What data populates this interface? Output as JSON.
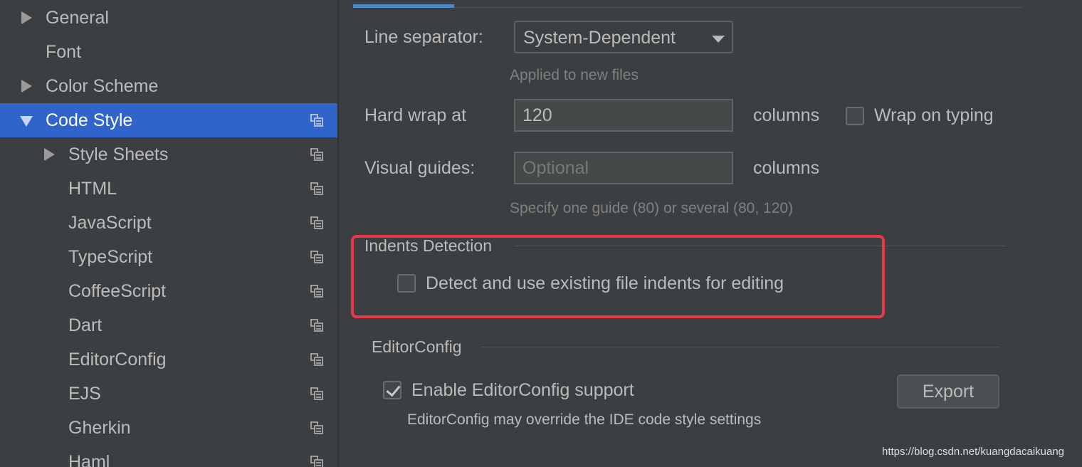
{
  "sidebar": {
    "items": [
      {
        "label": "General",
        "arrow": "right",
        "indent": 0,
        "copy_icon": false,
        "selected": false
      },
      {
        "label": "Font",
        "arrow": "none",
        "indent": 0,
        "copy_icon": false,
        "selected": false
      },
      {
        "label": "Color Scheme",
        "arrow": "right",
        "indent": 0,
        "copy_icon": false,
        "selected": false
      },
      {
        "label": "Code Style",
        "arrow": "down",
        "indent": 0,
        "copy_icon": true,
        "selected": true
      },
      {
        "label": "Style Sheets",
        "arrow": "right",
        "indent": 1,
        "copy_icon": true,
        "selected": false
      },
      {
        "label": "HTML",
        "arrow": "none",
        "indent": 1,
        "copy_icon": true,
        "selected": false
      },
      {
        "label": "JavaScript",
        "arrow": "none",
        "indent": 1,
        "copy_icon": true,
        "selected": false
      },
      {
        "label": "TypeScript",
        "arrow": "none",
        "indent": 1,
        "copy_icon": true,
        "selected": false
      },
      {
        "label": "CoffeeScript",
        "arrow": "none",
        "indent": 1,
        "copy_icon": true,
        "selected": false
      },
      {
        "label": "Dart",
        "arrow": "none",
        "indent": 1,
        "copy_icon": true,
        "selected": false
      },
      {
        "label": "EditorConfig",
        "arrow": "none",
        "indent": 1,
        "copy_icon": true,
        "selected": false
      },
      {
        "label": "EJS",
        "arrow": "none",
        "indent": 1,
        "copy_icon": true,
        "selected": false
      },
      {
        "label": "Gherkin",
        "arrow": "none",
        "indent": 1,
        "copy_icon": true,
        "selected": false
      },
      {
        "label": "Haml",
        "arrow": "none",
        "indent": 1,
        "copy_icon": true,
        "selected": false
      }
    ]
  },
  "general": {
    "line_separator_label": "Line separator:",
    "line_separator_value": "System-Dependent",
    "line_separator_hint": "Applied to new files",
    "hard_wrap_label": "Hard wrap at",
    "hard_wrap_value": "120",
    "hard_wrap_unit": "columns",
    "wrap_on_typing_label": "Wrap on typing",
    "wrap_on_typing_checked": false,
    "visual_guides_label": "Visual guides:",
    "visual_guides_value": "",
    "visual_guides_placeholder": "Optional",
    "visual_guides_unit": "columns",
    "visual_guides_hint": "Specify one guide (80) or several (80, 120)"
  },
  "indents_detection": {
    "title": "Indents Detection",
    "checkbox_label": "Detect and use existing file indents for editing",
    "checked": false
  },
  "editorconfig": {
    "title": "EditorConfig",
    "enable_label": "Enable EditorConfig support",
    "enable_checked": true,
    "note": "EditorConfig may override the IDE code style settings",
    "export_label": "Export"
  },
  "watermark": "https://blog.csdn.net/kuangdacaikuang",
  "colors": {
    "background": "#3c3f41",
    "selection": "#2f65ca",
    "highlight_box": "#e8394a",
    "tab_accent": "#4a88c7"
  }
}
